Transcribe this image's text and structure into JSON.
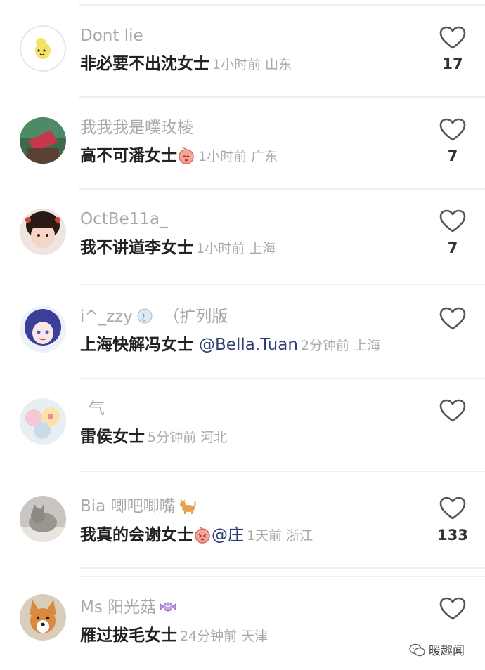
{
  "comments": [
    {
      "username": "Dont lie",
      "text": "非必要不出沈女士",
      "meta": "1小时前 山东",
      "likes": "17"
    },
    {
      "username": "我我我是噗玫棱",
      "text": "高不可潘女士",
      "meta": "1小时前 广东",
      "likes": "7"
    },
    {
      "username": "OctBe11a_",
      "text": "我不讲道李女士",
      "meta": "1小时前 上海",
      "likes": "7"
    },
    {
      "username": "i^_zzy",
      "username_suffix": "（扩列版",
      "text": "上海快解冯女士",
      "mention": "@Bella.Tuan",
      "meta": "2分钟前 上海",
      "likes": ""
    },
    {
      "username": "气",
      "text": "雷侯女士",
      "meta": "5分钟前 河北",
      "likes": ""
    },
    {
      "username": "Bia 唧吧唧嘴",
      "text": "我真的会谢女士",
      "mention": "@庄",
      "meta": "1天前 浙江",
      "likes": "133"
    },
    {
      "username": "Ms 阳光菇",
      "text": "雁过拔毛女士",
      "meta": "24分钟前 天津",
      "likes": ""
    }
  ],
  "icons": {
    "like": "heart-outline-icon",
    "peach_emoji": "peach-face-icon",
    "cat_emoji": "cat-emoji-icon",
    "candy_emoji": "candy-emoji-icon"
  },
  "watermark": {
    "text": "暖趣闻"
  },
  "colors": {
    "username": "#a9a9a9",
    "comment_text": "#222222",
    "mention": "#2c3e73",
    "divider": "#eeeeee"
  }
}
